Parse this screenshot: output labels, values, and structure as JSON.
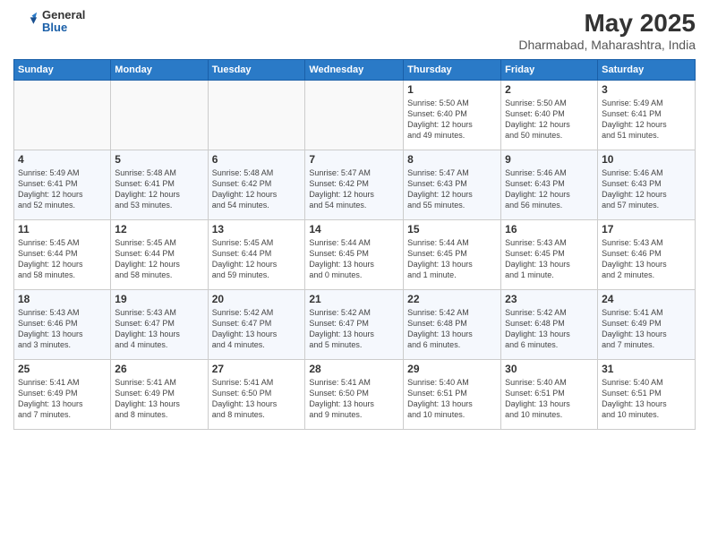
{
  "header": {
    "logo_general": "General",
    "logo_blue": "Blue",
    "month_title": "May 2025",
    "location": "Dharmabad, Maharashtra, India"
  },
  "weekdays": [
    "Sunday",
    "Monday",
    "Tuesday",
    "Wednesday",
    "Thursday",
    "Friday",
    "Saturday"
  ],
  "rows": [
    [
      {
        "day": "",
        "text": ""
      },
      {
        "day": "",
        "text": ""
      },
      {
        "day": "",
        "text": ""
      },
      {
        "day": "",
        "text": ""
      },
      {
        "day": "1",
        "text": "Sunrise: 5:50 AM\nSunset: 6:40 PM\nDaylight: 12 hours\nand 49 minutes."
      },
      {
        "day": "2",
        "text": "Sunrise: 5:50 AM\nSunset: 6:40 PM\nDaylight: 12 hours\nand 50 minutes."
      },
      {
        "day": "3",
        "text": "Sunrise: 5:49 AM\nSunset: 6:41 PM\nDaylight: 12 hours\nand 51 minutes."
      }
    ],
    [
      {
        "day": "4",
        "text": "Sunrise: 5:49 AM\nSunset: 6:41 PM\nDaylight: 12 hours\nand 52 minutes."
      },
      {
        "day": "5",
        "text": "Sunrise: 5:48 AM\nSunset: 6:41 PM\nDaylight: 12 hours\nand 53 minutes."
      },
      {
        "day": "6",
        "text": "Sunrise: 5:48 AM\nSunset: 6:42 PM\nDaylight: 12 hours\nand 54 minutes."
      },
      {
        "day": "7",
        "text": "Sunrise: 5:47 AM\nSunset: 6:42 PM\nDaylight: 12 hours\nand 54 minutes."
      },
      {
        "day": "8",
        "text": "Sunrise: 5:47 AM\nSunset: 6:43 PM\nDaylight: 12 hours\nand 55 minutes."
      },
      {
        "day": "9",
        "text": "Sunrise: 5:46 AM\nSunset: 6:43 PM\nDaylight: 12 hours\nand 56 minutes."
      },
      {
        "day": "10",
        "text": "Sunrise: 5:46 AM\nSunset: 6:43 PM\nDaylight: 12 hours\nand 57 minutes."
      }
    ],
    [
      {
        "day": "11",
        "text": "Sunrise: 5:45 AM\nSunset: 6:44 PM\nDaylight: 12 hours\nand 58 minutes."
      },
      {
        "day": "12",
        "text": "Sunrise: 5:45 AM\nSunset: 6:44 PM\nDaylight: 12 hours\nand 58 minutes."
      },
      {
        "day": "13",
        "text": "Sunrise: 5:45 AM\nSunset: 6:44 PM\nDaylight: 12 hours\nand 59 minutes."
      },
      {
        "day": "14",
        "text": "Sunrise: 5:44 AM\nSunset: 6:45 PM\nDaylight: 13 hours\nand 0 minutes."
      },
      {
        "day": "15",
        "text": "Sunrise: 5:44 AM\nSunset: 6:45 PM\nDaylight: 13 hours\nand 1 minute."
      },
      {
        "day": "16",
        "text": "Sunrise: 5:43 AM\nSunset: 6:45 PM\nDaylight: 13 hours\nand 1 minute."
      },
      {
        "day": "17",
        "text": "Sunrise: 5:43 AM\nSunset: 6:46 PM\nDaylight: 13 hours\nand 2 minutes."
      }
    ],
    [
      {
        "day": "18",
        "text": "Sunrise: 5:43 AM\nSunset: 6:46 PM\nDaylight: 13 hours\nand 3 minutes."
      },
      {
        "day": "19",
        "text": "Sunrise: 5:43 AM\nSunset: 6:47 PM\nDaylight: 13 hours\nand 4 minutes."
      },
      {
        "day": "20",
        "text": "Sunrise: 5:42 AM\nSunset: 6:47 PM\nDaylight: 13 hours\nand 4 minutes."
      },
      {
        "day": "21",
        "text": "Sunrise: 5:42 AM\nSunset: 6:47 PM\nDaylight: 13 hours\nand 5 minutes."
      },
      {
        "day": "22",
        "text": "Sunrise: 5:42 AM\nSunset: 6:48 PM\nDaylight: 13 hours\nand 6 minutes."
      },
      {
        "day": "23",
        "text": "Sunrise: 5:42 AM\nSunset: 6:48 PM\nDaylight: 13 hours\nand 6 minutes."
      },
      {
        "day": "24",
        "text": "Sunrise: 5:41 AM\nSunset: 6:49 PM\nDaylight: 13 hours\nand 7 minutes."
      }
    ],
    [
      {
        "day": "25",
        "text": "Sunrise: 5:41 AM\nSunset: 6:49 PM\nDaylight: 13 hours\nand 7 minutes."
      },
      {
        "day": "26",
        "text": "Sunrise: 5:41 AM\nSunset: 6:49 PM\nDaylight: 13 hours\nand 8 minutes."
      },
      {
        "day": "27",
        "text": "Sunrise: 5:41 AM\nSunset: 6:50 PM\nDaylight: 13 hours\nand 8 minutes."
      },
      {
        "day": "28",
        "text": "Sunrise: 5:41 AM\nSunset: 6:50 PM\nDaylight: 13 hours\nand 9 minutes."
      },
      {
        "day": "29",
        "text": "Sunrise: 5:40 AM\nSunset: 6:51 PM\nDaylight: 13 hours\nand 10 minutes."
      },
      {
        "day": "30",
        "text": "Sunrise: 5:40 AM\nSunset: 6:51 PM\nDaylight: 13 hours\nand 10 minutes."
      },
      {
        "day": "31",
        "text": "Sunrise: 5:40 AM\nSunset: 6:51 PM\nDaylight: 13 hours\nand 10 minutes."
      }
    ]
  ]
}
